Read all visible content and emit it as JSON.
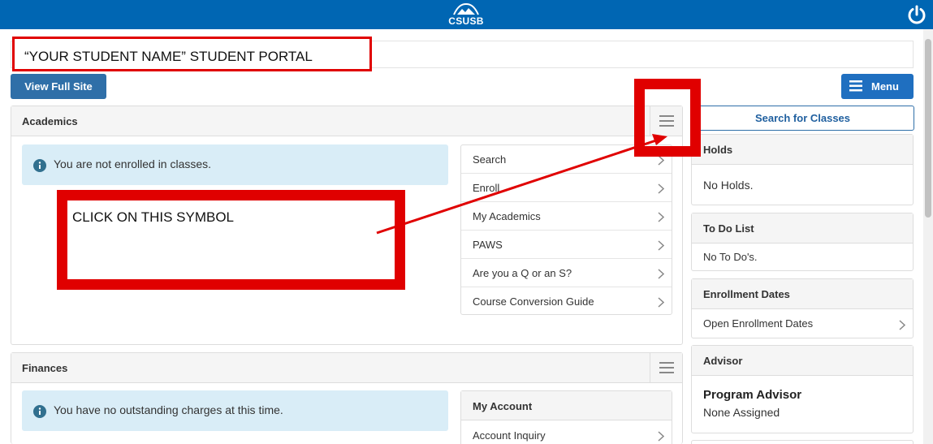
{
  "header": {
    "logo_text": "CSUSB",
    "power_icon": "power-icon"
  },
  "student_name": "“YOUR STUDENT NAME”  STUDENT PORTAL",
  "buttons": {
    "view_full_site": "View Full Site",
    "menu": "Menu"
  },
  "academics": {
    "title": "Academics",
    "alert": "You are not enrolled in classes.",
    "links": [
      "Search",
      "Enroll",
      "My Academics",
      "PAWS",
      "Are you a Q or an S?",
      "Course Conversion Guide"
    ]
  },
  "finances": {
    "title": "Finances",
    "alert": "You have no outstanding charges at this time.",
    "account_title": "My Account",
    "account_links": [
      "Account Inquiry"
    ]
  },
  "sidebar": {
    "search_classes": "Search for Classes",
    "holds": {
      "title": "Holds",
      "body": "No Holds."
    },
    "todo": {
      "title": "To Do List",
      "body": "No To Do's."
    },
    "enrollment": {
      "title": "Enrollment Dates",
      "link": "Open Enrollment Dates"
    },
    "advisor": {
      "title": "Advisor",
      "name": "Program Advisor",
      "value": "None Assigned"
    }
  },
  "annotation": {
    "text": "CLICK ON THIS SYMBOL",
    "color": "#e00000"
  },
  "colors": {
    "brand": "#0066b3",
    "button": "#2f6fa8",
    "alert_bg": "#d9edf7"
  }
}
